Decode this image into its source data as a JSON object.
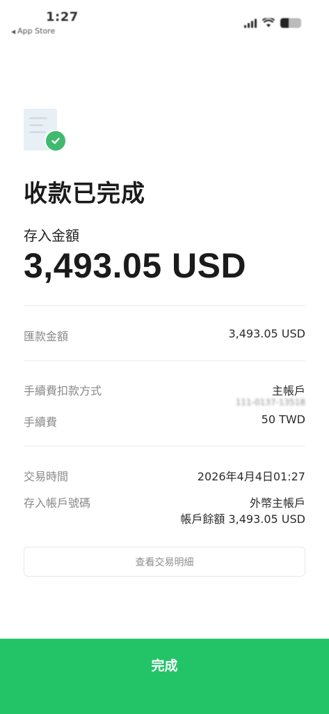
{
  "status_bar": {
    "time": "1:27",
    "back_app": "App Store"
  },
  "receipt": {
    "title": "收款已完成",
    "amount_label": "存入金額",
    "amount_value": "3,493.05 USD",
    "remit_amount": {
      "label": "匯款金額",
      "value": "3,493.05 USD"
    },
    "fee_method": {
      "label": "手續費扣款方式",
      "value": "主帳戶",
      "account": "111-0137-13518"
    },
    "fee": {
      "label": "手續費",
      "value": "50 TWD"
    },
    "txn_time": {
      "label": "交易時間",
      "value": "2026年4月4日01:27"
    },
    "deposit_account": {
      "label": "存入帳戶號碼",
      "value": "外幣主帳戶",
      "balance": "帳戶餘額 3,493.05 USD"
    }
  },
  "actions": {
    "view_details": "查看交易明細",
    "done": "完成"
  },
  "colors": {
    "accent": "#23c468",
    "check_badge": "#3fba6e"
  },
  "icons": {
    "status": [
      "signal-icon",
      "wifi-icon",
      "battery-icon"
    ],
    "hero": [
      "document-icon",
      "check-icon"
    ]
  }
}
